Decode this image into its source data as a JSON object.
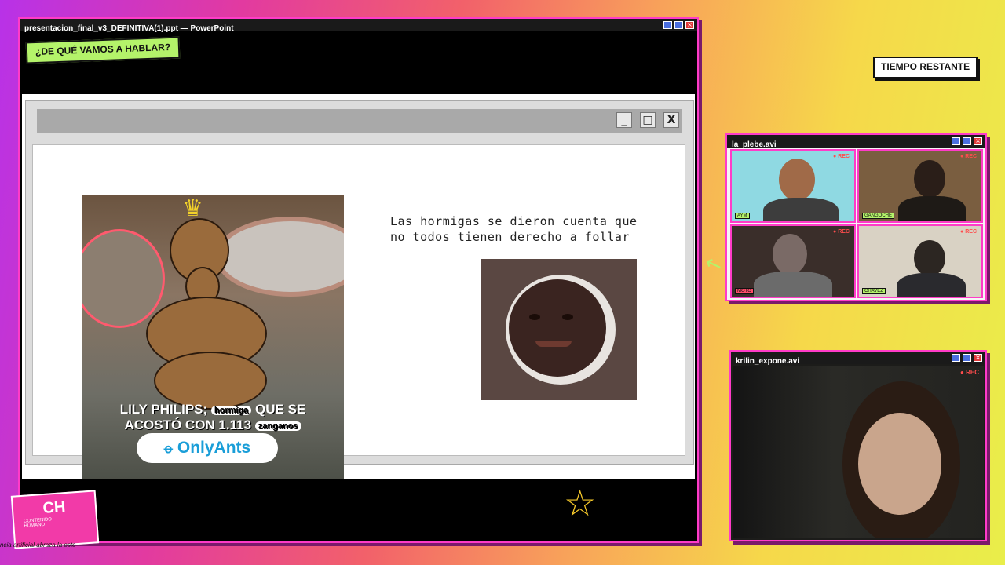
{
  "ppt_window": {
    "title": "presentacion_final_v3_DEFINITIVA(1).ppt — PowerPoint",
    "topic_label": "¿DE QUÉ VAMOS A HABLAR?",
    "slide_window_buttons": {
      "minimize": "_",
      "maximize": "□",
      "close": "X"
    },
    "slide": {
      "text": "Las hormigas se dieron cuenta que no todos tienen derecho a follar",
      "meme_caption_1a": "LILY PHILIPS;",
      "meme_caption_pill_1": "hormiga",
      "meme_caption_1b": "QUE SE",
      "meme_caption_2a": "ACOSTÓ CON 1.113",
      "meme_caption_pill_2": "zanganos",
      "meme_brand": "OnlyAnts"
    }
  },
  "timer_label": "TIEMPO RESTANTE",
  "cam_group_window": {
    "title": "la_plebe.avi",
    "tiles": [
      {
        "name_tag": "AYM",
        "rec": "● REC"
      },
      {
        "name_tag": "GANGOCHE",
        "rec": "● REC"
      },
      {
        "name_tag": "MOTO",
        "rec": "● REC"
      },
      {
        "name_tag": "CHAVEZ",
        "rec": "● REC"
      }
    ]
  },
  "cam_main_window": {
    "title": "krilin_expone.avi",
    "rec": "● REC"
  },
  "logo": {
    "initials": "CH",
    "line1": "CONTENIDO",
    "line2": "HUMANO",
    "tagline": "ncia artificial abraza la este"
  },
  "colors": {
    "accent_pink": "#ff3bc8",
    "topic_green": "#b4f36a",
    "star_yellow": "#f5c82a"
  }
}
